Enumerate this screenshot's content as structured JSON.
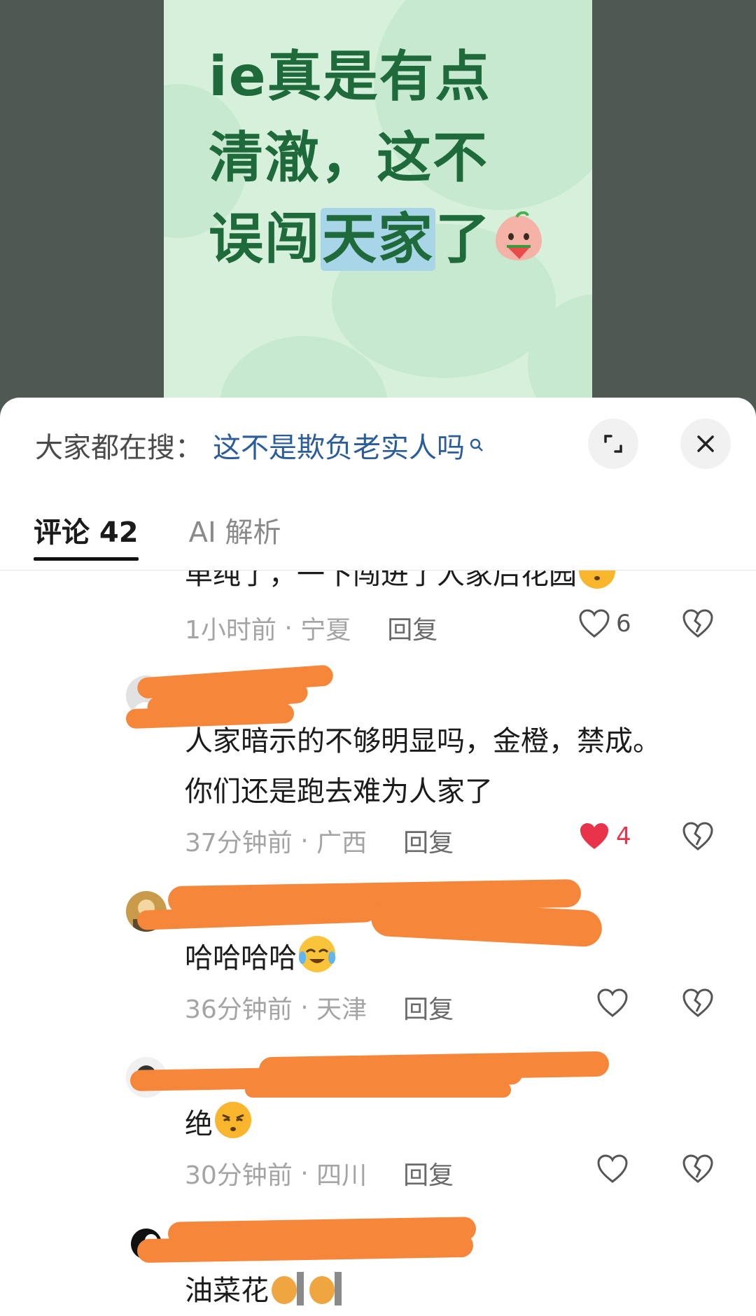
{
  "media": {
    "line1": "ie真是有点",
    "line2": "清澈，这不",
    "line3_prefix": "误闯",
    "line3_highlight": "天家",
    "line3_suffix": "了",
    "sticker_icon": "peach-watermelon-sticker-icon",
    "text_color": "#1e6a3b",
    "background_color": "#d6f0dc"
  },
  "sheet": {
    "search_prefix": "大家都在搜：",
    "search_term": "这不是欺负老实人吗",
    "expand_icon": "expand-icon",
    "close_icon": "close-icon"
  },
  "tabs": [
    {
      "label": "评论 42",
      "active": true
    },
    {
      "label": "AI 解析",
      "active": false
    }
  ],
  "comments": [
    {
      "text": "单纯了，一下闯进了人家后花园",
      "emoji": "smirk-emoji-icon",
      "time": "1小时前",
      "location": "宁夏",
      "reply": "回复",
      "likes": "6",
      "liked": false
    },
    {
      "username": "",
      "text_line1": "人家暗示的不够明显吗，金橙，禁成。",
      "text_line2": "你们还是跑去难为人家了",
      "time": "37分钟前",
      "location": "广西",
      "reply": "回复",
      "likes": "4",
      "liked": true
    },
    {
      "username": "",
      "text": "哈哈哈哈",
      "emoji": "crying-laughing-emoji-icon",
      "time": "36分钟前",
      "location": "天津",
      "reply": "回复",
      "likes": "",
      "liked": false
    },
    {
      "username": "",
      "text": "绝",
      "emoji": "smug-emoji-icon",
      "time": "30分钟前",
      "location": "四川",
      "reply": "回复",
      "likes": "",
      "liked": false
    },
    {
      "username": "",
      "text": "油菜花",
      "emoji": "cat-pillar-sticker-icon"
    }
  ],
  "colors": {
    "accent_link": "#2a5d9a",
    "liked_red": "#e8334a",
    "redaction_orange": "#f5863a"
  }
}
